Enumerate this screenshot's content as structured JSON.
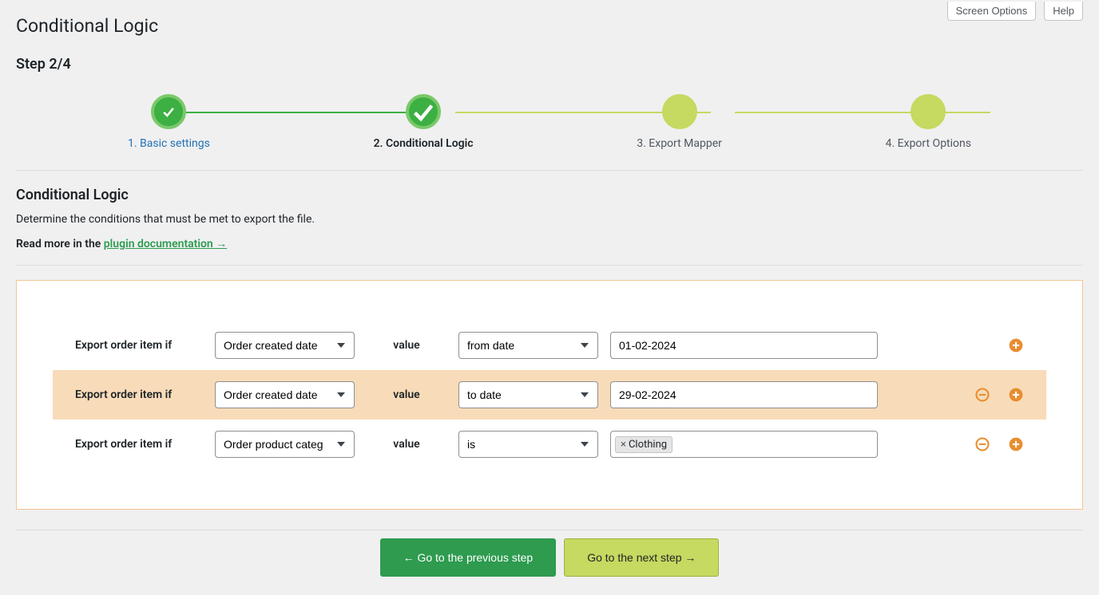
{
  "header": {
    "page_title": "Conditional Logic",
    "screen_options": "Screen Options",
    "help": "Help"
  },
  "step_counter": "Step 2/4",
  "steps": [
    {
      "label": "1. Basic settings",
      "state": "done"
    },
    {
      "label": "2. Conditional Logic",
      "state": "current"
    },
    {
      "label": "3. Export Mapper",
      "state": "todo"
    },
    {
      "label": "4. Export Options",
      "state": "todo"
    }
  ],
  "section": {
    "title": "Conditional Logic",
    "description": "Determine the conditions that must be met to export the file.",
    "readmore_prefix": "Read more in the ",
    "readmore_link": "plugin documentation →"
  },
  "rules": [
    {
      "label": "Export order item if",
      "field": "Order created date",
      "value_label": "value",
      "operator": "from date",
      "input_type": "text",
      "input_value": "01-02-2024",
      "highlighted": false,
      "show_remove": false
    },
    {
      "label": "Export order item if",
      "field": "Order created date",
      "value_label": "value",
      "operator": "to date",
      "input_type": "text",
      "input_value": "29-02-2024",
      "highlighted": true,
      "show_remove": true
    },
    {
      "label": "Export order item if",
      "field": "Order product categ",
      "value_label": "value",
      "operator": "is",
      "input_type": "tag",
      "tag_value": "Clothing",
      "highlighted": false,
      "show_remove": true
    }
  ],
  "footer": {
    "prev": "← Go to the previous step",
    "next": "Go to the next step →"
  },
  "colors": {
    "accent_orange": "#e88d2f",
    "accent_green": "#3cb043",
    "step_todo": "#c6d960"
  }
}
